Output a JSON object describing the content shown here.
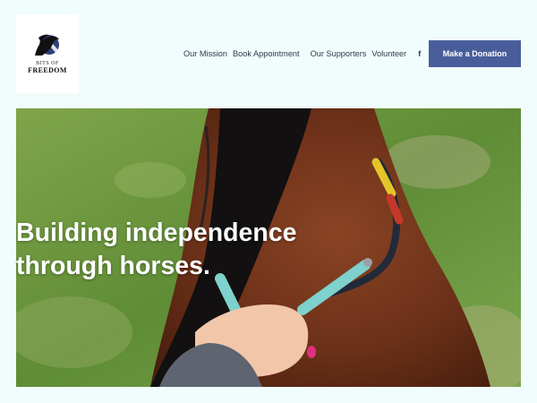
{
  "logo": {
    "line1": "BITS OF",
    "line2": "FREEDOM"
  },
  "nav": {
    "items": [
      "Our Mission",
      "Book Appointment",
      "Our Supporters",
      "Volunteer"
    ],
    "facebook_glyph": "f"
  },
  "donate": {
    "label": "Make a Donation"
  },
  "hero": {
    "heading": "Building independence through horses."
  },
  "colors": {
    "page_bg": "#f1fdfd",
    "button": "#4a5d9b",
    "nav_text": "#30384a"
  }
}
